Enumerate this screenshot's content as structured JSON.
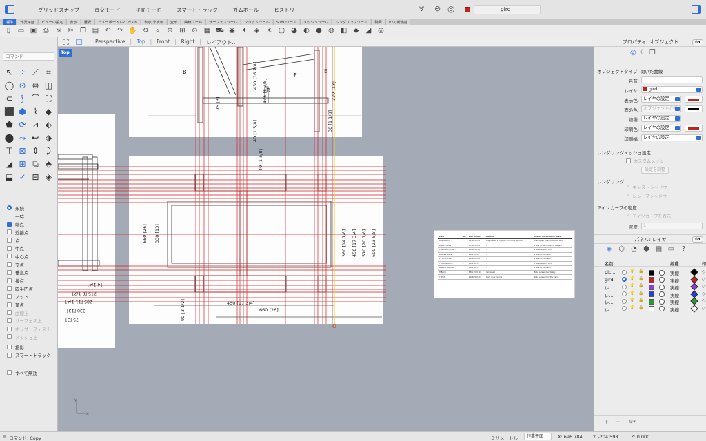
{
  "titlebar": {
    "modes": [
      "グリッドスナップ",
      "直交モード",
      "平面モード",
      "スマートトラック",
      "ガムボール",
      "ヒストリ"
    ],
    "current_layer": "gird",
    "layer_color": "#c0231a"
  },
  "tabs": [
    "標準",
    "作業平面",
    "ビューの設定",
    "表示",
    "選択",
    "ビューポートレイアウト",
    "表示/非表示",
    "変形",
    "曲線ツール",
    "サーフェスツール",
    "ソリッドツール",
    "SubDツール",
    "メッシュツール",
    "レンダリングツール",
    "製図",
    "V7の新機能"
  ],
  "toolbar_icons": [
    "new-file",
    "open",
    "save",
    "print",
    "import",
    "cut",
    "copy",
    "paste",
    "undo",
    "redo",
    "pan",
    "rotate",
    "zoom",
    "zoom-window",
    "zoom-extents",
    "zoom-selected",
    "grid",
    "car",
    "eye",
    "light",
    "layer",
    "lightbulb",
    "display",
    "render",
    "color",
    "sphere",
    "globe",
    "cube",
    "material",
    "wedge",
    "globe2"
  ],
  "command": {
    "placeholder": "コマンド"
  },
  "viewport": {
    "label": "Top",
    "tabs": [
      "Perspective",
      "Top",
      "Front",
      "Right",
      "レイアウト..."
    ],
    "active_tab": "Top",
    "axis_x": "x",
    "axis_y": "y"
  },
  "snaps": {
    "mode_items": [
      {
        "label": "永続",
        "selected": true
      },
      {
        "label": "一時",
        "selected": false
      }
    ],
    "items": [
      {
        "label": "端点",
        "checked": true,
        "enabled": true
      },
      {
        "label": "近接点",
        "checked": false,
        "enabled": true
      },
      {
        "label": "点",
        "checked": false,
        "enabled": true
      },
      {
        "label": "中点",
        "checked": false,
        "enabled": true
      },
      {
        "label": "中心点",
        "checked": false,
        "enabled": true
      },
      {
        "label": "交点",
        "checked": false,
        "enabled": true
      },
      {
        "label": "垂直点",
        "checked": false,
        "enabled": true
      },
      {
        "label": "接点",
        "checked": false,
        "enabled": true
      },
      {
        "label": "四半円点",
        "checked": false,
        "enabled": true
      },
      {
        "label": "ノット",
        "checked": false,
        "enabled": true
      },
      {
        "label": "頂点",
        "checked": false,
        "enabled": true
      },
      {
        "label": "曲線上",
        "checked": false,
        "enabled": false
      },
      {
        "label": "サーフェス上",
        "checked": false,
        "enabled": false
      },
      {
        "label": "ポリサーフェス上",
        "checked": false,
        "enabled": false
      },
      {
        "label": "メッシュ上",
        "checked": false,
        "enabled": false
      },
      {
        "label": "投影",
        "checked": false,
        "enabled": true
      },
      {
        "label": "スマートトラック",
        "checked": false,
        "enabled": true
      }
    ],
    "disable_all": "すべて無効"
  },
  "properties": {
    "title": "プロパティ: オブジェクト",
    "object_type_label": "オブジェクトタイプ:",
    "object_type": "開いた曲線",
    "name_label": "名前:",
    "name_value": "",
    "layer_label": "レイヤ:",
    "layer_value": "gird",
    "display_color_label": "表示色:",
    "display_color_value": "レイヤの設定",
    "display_color": "#c0231a",
    "face_color_label": "面の色:",
    "face_color_value": "オブジェクトから",
    "face_color": "#000000",
    "linetype_label": "線種:",
    "linetype_value": "レイヤの設定",
    "print_color_label": "印刷色:",
    "print_color_value": "レイヤの設定",
    "print_color": "#c0231a",
    "print_width_label": "印刷幅:",
    "print_width_value": "レイヤの設定",
    "render_mesh_section": "レンダリングメッシュ設定",
    "custom_mesh": "カスタムメッシュ",
    "adjust_settings": "設定を調整",
    "rendering_section": "レンダリング",
    "cast_shadows": "キャストシャドウ",
    "receive_shadows": "レシーブシャドウ",
    "isocurve_section": "アイソカーブの密度",
    "show_isocurves": "アイソカーブを表示",
    "density_label": "密度:",
    "density_value": "1"
  },
  "layers": {
    "title": "パネル: レイヤ",
    "col_name": "名前",
    "col_linetype": "線種",
    "col_extra": "印",
    "rows": [
      {
        "name": "pic...",
        "current": false,
        "color": "#000000",
        "linetype": "実線",
        "print_color": "#000000"
      },
      {
        "name": "gird",
        "current": true,
        "color": "#c0231a",
        "linetype": "実線",
        "print_color": "#c0231a"
      },
      {
        "name": "レ...",
        "current": false,
        "color": "#8a3fd0",
        "linetype": "実線",
        "print_color": "#8a3fd0"
      },
      {
        "name": "レ...",
        "current": false,
        "color": "#2540d0",
        "linetype": "実線",
        "print_color": "#2540d0"
      },
      {
        "name": "レ...",
        "current": false,
        "color": "#2a9a30",
        "linetype": "実線",
        "print_color": "#2a9a30"
      },
      {
        "name": "レ...",
        "current": false,
        "color": "#ffffff",
        "linetype": "実線",
        "print_color": "#ffffff"
      }
    ]
  },
  "drawing": {
    "dims": [
      "330 [13]",
      "75 [3]",
      "175 [6 7/8]",
      "430 [16 7/8]",
      "40 [1 5/8]",
      "30 [1 1/8]",
      "40 [1 5/8]",
      "660 [26]",
      "330 [13]",
      "360 [14 1/8]",
      "450 [17 3/4]",
      "510 [20 1/8]",
      "600 [23 5/8]",
      "450 [17 3/4]",
      "660 [26]",
      "90 [3 1/2]"
    ],
    "side_dims": [
      "285 [11 1/4]",
      "215 [8 1/2]",
      "330 [13]",
      "75 [3]",
      "[4 1/4]"
    ],
    "letters": [
      "B",
      "D",
      "E",
      "F"
    ]
  },
  "schedule": {
    "headers": [
      "ITEM",
      "NO.",
      "DIM. in mm",
      "COLOUR",
      "DOWEL HOLES LOCATIONS"
    ],
    "rows": [
      [
        "A ARMREST",
        "2",
        "1450x50x20",
        "Bright stain in cappuccino colour varnish",
        "Interrupted so as to fit both ends"
      ],
      [
        "B BACK LEGS",
        "2",
        "1770x50x30",
        "-",
        "1 hole on each side for the arm"
      ],
      [
        "C ARMREST FORTH",
        "2",
        "1500x50x30",
        "-",
        "2 holes at each end"
      ],
      [
        "D LONG RAILS",
        "4",
        "660x30x30",
        "-",
        "1 hole at each end"
      ],
      [
        "E FRONT LEGS",
        "2",
        "2290x30x30",
        "-",
        "1 hole at each end"
      ],
      [
        "F CROSS RAILS",
        "4",
        "600x30x30",
        "-",
        "2 holes at each end"
      ],
      [
        "G BACK BATTEN",
        "1",
        "840x30x30",
        "-",
        "1 hole at each end"
      ],
      [
        "H BACK",
        "1",
        "830x1330x11",
        "Varnished",
        "To be screwed vertically"
      ],
      [
        "I SEAT",
        "1",
        "1006x360x11",
        "Dark olive marine",
        "To be screwed on the frame"
      ]
    ]
  },
  "status": {
    "command": "コマンド: Copy",
    "unit": "ミリメートル",
    "cplane": "作業平面",
    "x": "X: 696.784",
    "y": "Y: -204.598",
    "z": "Z: 0.000"
  }
}
